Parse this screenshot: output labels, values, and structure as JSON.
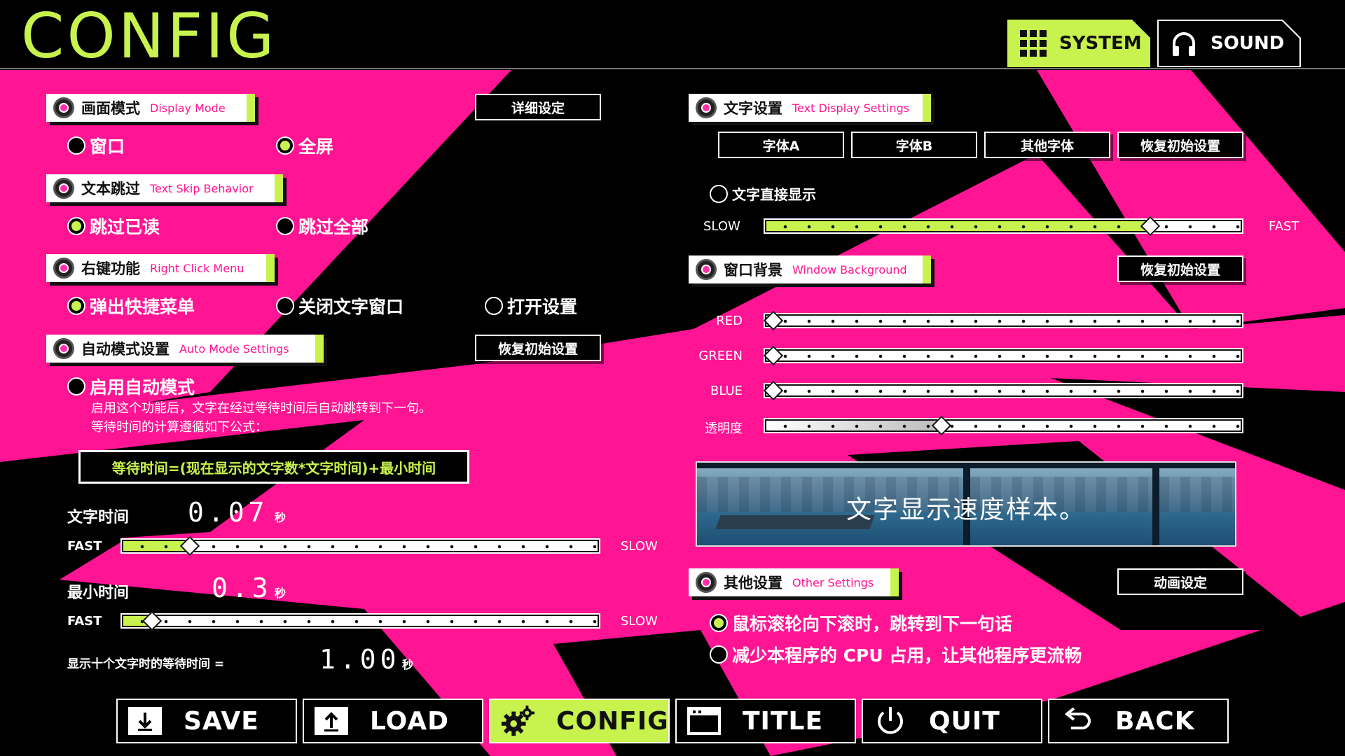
{
  "screen_title": "CONFIG",
  "header_tabs": [
    {
      "label": "SYSTEM",
      "icon": "grid-icon",
      "active": true
    },
    {
      "label": "SOUND",
      "icon": "headphones-icon",
      "active": false
    }
  ],
  "colors": {
    "accent": "#c8f24e",
    "magenta": "#ff1493",
    "background": "#000000"
  },
  "display_mode": {
    "title_zh": "画面模式",
    "title_en": "Display Mode",
    "button": "详细设定",
    "options": [
      {
        "label": "窗口",
        "selected": false
      },
      {
        "label": "全屏",
        "selected": true
      }
    ]
  },
  "text_skip": {
    "title_zh": "文本跳过",
    "title_en": "Text Skip Behavior",
    "options": [
      {
        "label": "跳过已读",
        "selected": true
      },
      {
        "label": "跳过全部",
        "selected": false
      }
    ]
  },
  "right_click": {
    "title_zh": "右键功能",
    "title_en": "Right Click Menu",
    "options": [
      {
        "label": "弹出快捷菜单",
        "selected": true
      },
      {
        "label": "关闭文字窗口",
        "selected": false
      },
      {
        "label": "打开设置",
        "selected": false
      }
    ]
  },
  "auto_mode": {
    "title_zh": "自动模式设置",
    "title_en": "Auto Mode Settings",
    "button": "恢复初始设置",
    "enable": {
      "label": "启用自动模式",
      "selected": false
    },
    "desc_line1": "启用这个功能后，文字在经过等待时间后自动跳转到下一句。",
    "desc_line2": "等待时间的计算遵循如下公式：",
    "formula": "等待时间=(现在显示的文字数*文字时间)+最小时间",
    "text_time": {
      "label": "文字时间",
      "value": "0.07",
      "unit": "秒",
      "fast": "FAST",
      "slow": "SLOW",
      "level": 0.14
    },
    "min_time": {
      "label": "最小时间",
      "value": "0.3",
      "unit": "秒",
      "fast": "FAST",
      "slow": "SLOW",
      "level": 0.06
    },
    "ten_chars": {
      "label": "显示十个文字时的等待时间 =",
      "value": "1.00",
      "unit": "秒"
    }
  },
  "text_display": {
    "title_zh": "文字设置",
    "title_en": "Text Display Settings",
    "buttons": [
      "字体A",
      "字体B",
      "其他字体",
      "恢复初始设置"
    ],
    "instant": {
      "label": "文字直接显示",
      "selected": false
    },
    "speed": {
      "slow": "SLOW",
      "fast": "FAST",
      "level": 0.81
    }
  },
  "window_bg": {
    "title_zh": "窗口背景",
    "title_en": "Window Background",
    "button": "恢复初始设置",
    "sliders": [
      {
        "label": "RED",
        "level": 0.0
      },
      {
        "label": "GREEN",
        "level": 0.0
      },
      {
        "label": "BLUE",
        "level": 0.0
      },
      {
        "label": "透明度",
        "level": 0.37
      }
    ]
  },
  "preview_text": "文字显示速度样本。",
  "other": {
    "title_zh": "其他设置",
    "title_en": "Other Settings",
    "button": "动画设定",
    "options": [
      {
        "label": "鼠标滚轮向下滚时，跳转到下一句话",
        "selected": true
      },
      {
        "label": "减少本程序的 CPU 占用，让其他程序更流畅",
        "selected": false
      }
    ]
  },
  "bottom_nav": [
    {
      "label": "SAVE",
      "icon": "save-icon",
      "active": false
    },
    {
      "label": "LOAD",
      "icon": "load-icon",
      "active": false
    },
    {
      "label": "CONFIG",
      "icon": "gear-icon",
      "active": true
    },
    {
      "label": "TITLE",
      "icon": "window-icon",
      "active": false
    },
    {
      "label": "QUIT",
      "icon": "power-icon",
      "active": false
    },
    {
      "label": "BACK",
      "icon": "back-arrow-icon",
      "active": false
    }
  ]
}
